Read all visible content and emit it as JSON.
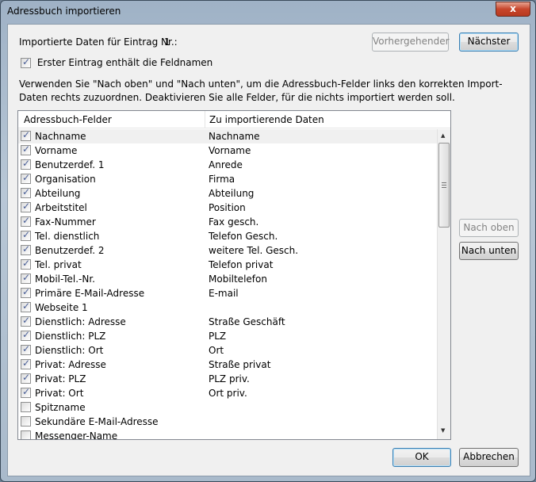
{
  "window": {
    "title": "Adressbuch importieren",
    "close_label": "x"
  },
  "record": {
    "label": "Importierte Daten für Eintrag Nr.:",
    "number": "1"
  },
  "buttons": {
    "previous": "Vorhergehender",
    "next": "Nächster",
    "up": "Nach oben",
    "down": "Nach unten",
    "ok": "OK",
    "cancel": "Abbrechen"
  },
  "first_row_checkbox": {
    "label": "Erster Eintrag enthält die Feldnamen",
    "checked": true
  },
  "instructions": "Verwenden Sie \"Nach oben\" und \"Nach unten\", um die Adressbuch-Felder links den korrekten Import-Daten rechts zuzuordnen. Deaktivieren Sie alle Felder, für die nichts importiert werden soll.",
  "list": {
    "columns": [
      "Adressbuch-Felder",
      "Zu importierende Daten"
    ],
    "rows": [
      {
        "field": "Nachname",
        "data": "Nachname",
        "checked": true
      },
      {
        "field": "Vorname",
        "data": "Vorname",
        "checked": true
      },
      {
        "field": "Benutzerdef. 1",
        "data": "Anrede",
        "checked": true
      },
      {
        "field": "Organisation",
        "data": "Firma",
        "checked": true
      },
      {
        "field": "Abteilung",
        "data": "Abteilung",
        "checked": true
      },
      {
        "field": "Arbeitstitel",
        "data": "Position",
        "checked": true
      },
      {
        "field": "Fax-Nummer",
        "data": "Fax gesch.",
        "checked": true
      },
      {
        "field": "Tel. dienstlich",
        "data": "Telefon Gesch.",
        "checked": true
      },
      {
        "field": "Benutzerdef. 2",
        "data": "weitere Tel. Gesch.",
        "checked": true
      },
      {
        "field": "Tel. privat",
        "data": "Telefon privat",
        "checked": true
      },
      {
        "field": "Mobil-Tel.-Nr.",
        "data": "Mobiltelefon",
        "checked": true
      },
      {
        "field": "Primäre E-Mail-Adresse",
        "data": "E-mail",
        "checked": true
      },
      {
        "field": "Webseite 1",
        "data": "",
        "checked": true
      },
      {
        "field": "Dienstlich: Adresse",
        "data": "Straße Geschäft",
        "checked": true
      },
      {
        "field": "Dienstlich: PLZ",
        "data": "PLZ",
        "checked": true
      },
      {
        "field": "Dienstlich: Ort",
        "data": "Ort",
        "checked": true
      },
      {
        "field": "Privat: Adresse",
        "data": "Straße privat",
        "checked": true
      },
      {
        "field": "Privat: PLZ",
        "data": "PLZ priv.",
        "checked": true
      },
      {
        "field": "Privat: Ort",
        "data": "Ort priv.",
        "checked": true
      },
      {
        "field": "Spitzname",
        "data": "",
        "checked": false
      },
      {
        "field": "Sekundäre E-Mail-Adresse",
        "data": "",
        "checked": false
      },
      {
        "field": "Messenger-Name",
        "data": "",
        "checked": false
      }
    ]
  }
}
